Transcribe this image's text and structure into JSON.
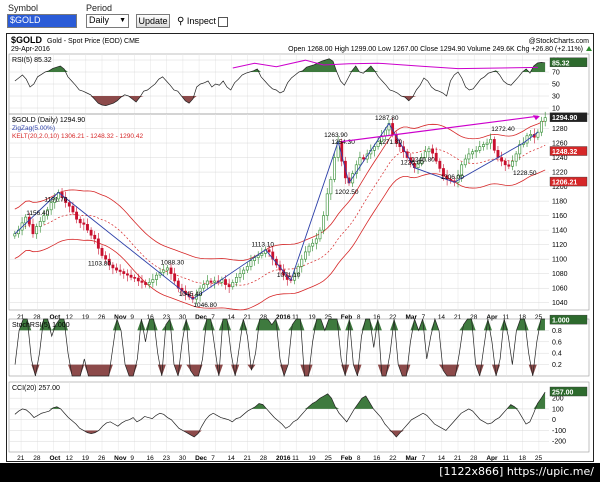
{
  "controls": {
    "symbol_label": "Symbol",
    "symbol_value": "$GOLD",
    "period_label": "Period",
    "period_value": "Daily",
    "update_label": "Update",
    "inspect_label": "Inspect"
  },
  "header": {
    "title": "$GOLD",
    "subtitle": "Gold - Spot Price (EOD)",
    "exchange": "CME",
    "site": "@StockCharts.com",
    "date": "29-Apr-2016",
    "ohlc": "Open 1268.00  High 1299.00  Low 1267.00  Close 1294.90  Volume 249.6K  Chg +26.80 (+2.11%)",
    "change_icon": "up-triangle-icon"
  },
  "legends": {
    "rsi": "RSI(5) 85.32",
    "price": "$GOLD (Daily) 1294.90",
    "zigzag": "ZigZag(5.00%)",
    "kelt": "KELT(20,2.0,10) 1306.21 - 1248.32 - 1290.42",
    "stochrsi": "StochRSI(5) 1.000",
    "cci": "CCI(20) 257.00"
  },
  "footer": "[1122x866] https://upic.me/",
  "colors": {
    "candle_up": "#2d8a2d",
    "candle_down": "#c8102e",
    "indicator_fill_high": "#3e7a3e",
    "indicator_fill_low": "#8c4a4a",
    "keltner": "#d62728",
    "zigzag": "#2c3fa8",
    "annotation": "#cc00cc",
    "grid": "#d8d8d8"
  },
  "chart_data": {
    "type": "candlestick",
    "period": "daily",
    "x_tick_labels": [
      "21",
      "28",
      "Oct",
      "12",
      "19",
      "26",
      "Nov",
      "9",
      "16",
      "23",
      "30",
      "Dec",
      "7",
      "14",
      "21",
      "28",
      "2016",
      "11",
      "19",
      "25",
      "Feb",
      "8",
      "16",
      "22",
      "Mar",
      "7",
      "14",
      "21",
      "28",
      "Apr",
      "11",
      "18",
      "25"
    ],
    "close_series": [
      1135,
      1140,
      1150,
      1158,
      1148,
      1135,
      1145,
      1152,
      1160,
      1168,
      1178,
      1183,
      1192,
      1185,
      1178,
      1173,
      1165,
      1155,
      1150,
      1148,
      1140,
      1133,
      1128,
      1115,
      1105,
      1100,
      1092,
      1088,
      1085,
      1083,
      1080,
      1078,
      1075,
      1074,
      1070,
      1068,
      1065,
      1068,
      1072,
      1078,
      1082,
      1085,
      1088,
      1080,
      1070,
      1060,
      1056,
      1052,
      1048,
      1045,
      1050,
      1060,
      1065,
      1070,
      1068,
      1070,
      1068,
      1072,
      1065,
      1062,
      1068,
      1075,
      1080,
      1085,
      1090,
      1098,
      1102,
      1105,
      1108,
      1113,
      1110,
      1100,
      1092,
      1085,
      1078,
      1072,
      1071,
      1080,
      1090,
      1100,
      1110,
      1118,
      1122,
      1128,
      1140,
      1160,
      1190,
      1210,
      1240,
      1262,
      1235,
      1212,
      1205,
      1218,
      1230,
      1240,
      1238,
      1245,
      1250,
      1255,
      1262,
      1270,
      1278,
      1287,
      1272,
      1260,
      1255,
      1248,
      1240,
      1232,
      1226,
      1232,
      1240,
      1248,
      1252,
      1246,
      1235,
      1225,
      1215,
      1210,
      1208,
      1206,
      1215,
      1230,
      1238,
      1245,
      1248,
      1250,
      1255,
      1258,
      1260,
      1265,
      1250,
      1240,
      1235,
      1230,
      1228,
      1235,
      1245,
      1258,
      1260,
      1270,
      1272,
      1268,
      1275,
      1290,
      1295
    ],
    "price_labels": [
      {
        "text": "1156.40",
        "value": 1156.4
      },
      {
        "text": "1191.70",
        "value": 1191.7
      },
      {
        "text": "1103.80",
        "value": 1103.8
      },
      {
        "text": "1088.30",
        "value": 1088.3
      },
      {
        "text": "1045.40",
        "value": 1045.4
      },
      {
        "text": "1046.80",
        "value": 1046.8
      },
      {
        "text": "1113.10",
        "value": 1113.1
      },
      {
        "text": "1071.10",
        "value": 1071.1
      },
      {
        "text": "1263.90",
        "value": 1263.9
      },
      {
        "text": "1254.30",
        "value": 1254.3
      },
      {
        "text": "1202.50",
        "value": 1202.5
      },
      {
        "text": "1287.80",
        "value": 1287.8
      },
      {
        "text": "1271.30",
        "value": 1271.3
      },
      {
        "text": "1226.00",
        "value": 1226.0
      },
      {
        "text": "1246.80",
        "value": 1246.8
      },
      {
        "text": "1206.00",
        "value": 1206.0
      },
      {
        "text": "1272.40",
        "value": 1272.4
      },
      {
        "text": "1228.50",
        "value": 1228.5
      }
    ],
    "price_axis": {
      "ylim": [
        1030,
        1300
      ],
      "ticks": [
        1040,
        1060,
        1080,
        1100,
        1120,
        1140,
        1160,
        1180,
        1200,
        1220,
        1240,
        1260,
        1280
      ]
    },
    "price_tags": [
      "1294.90",
      "1248.32",
      "1206.21"
    ],
    "rsi": {
      "axis_ticks": [
        10,
        30,
        50,
        70,
        90
      ],
      "ylim": [
        0,
        100
      ],
      "tag": "85.32",
      "values": [
        55,
        60,
        65,
        58,
        45,
        50,
        62,
        66,
        70,
        72,
        76,
        78,
        80,
        75,
        62,
        55,
        48,
        40,
        38,
        35,
        32,
        25,
        18,
        15,
        14,
        16,
        18,
        22,
        28,
        32,
        30,
        25,
        20,
        28,
        38,
        40,
        45,
        50,
        58,
        62,
        55,
        48,
        40,
        38,
        30,
        22,
        18,
        25,
        45,
        50,
        52,
        55,
        45,
        50,
        48,
        55,
        45,
        40,
        52,
        58,
        65,
        68,
        70,
        72,
        75,
        62,
        55,
        48,
        42,
        40,
        35,
        38,
        52,
        60,
        65,
        70,
        72,
        78,
        80,
        82,
        85,
        88,
        90,
        92,
        88,
        70,
        55,
        48,
        60,
        72,
        80,
        70,
        68,
        74,
        80,
        72,
        62,
        55,
        48,
        40,
        38,
        35,
        30,
        28,
        22,
        28,
        40,
        48,
        60,
        55,
        45,
        40,
        38,
        35,
        30,
        55,
        65,
        70,
        60,
        45,
        40,
        42,
        50,
        58,
        62,
        68,
        70,
        72,
        65,
        55,
        50,
        48,
        55,
        62,
        70,
        75,
        68,
        80,
        85,
        86,
        85.3
      ]
    },
    "stochrsi": {
      "axis_ticks": [
        "0.8",
        "0.6",
        "0.4",
        "0.2"
      ],
      "ylim": [
        0,
        1
      ],
      "tag": "1.000",
      "values": [
        0.2,
        0.8,
        1,
        1,
        0.3,
        0,
        0.4,
        1,
        1,
        0.7,
        0.9,
        1,
        1,
        0.4,
        0,
        0,
        0,
        0.3,
        0,
        0,
        0,
        0,
        0,
        0,
        0.5,
        1,
        0.8,
        0.2,
        0,
        0,
        0.3,
        1,
        0.6,
        1,
        1,
        0.4,
        0,
        0.9,
        1,
        0.2,
        0,
        0.6,
        1,
        0.1,
        0,
        0,
        0.3,
        1,
        1,
        0.5,
        0,
        1,
        1,
        0.4,
        0,
        0.5,
        1,
        0.7,
        0.1,
        0.4,
        1,
        1,
        1,
        0.9,
        1,
        0.3,
        0,
        0.2,
        0.9,
        1,
        1,
        0,
        0,
        0.6,
        1,
        1,
        0.8,
        1,
        1,
        1,
        0.3,
        0,
        1,
        0.2,
        0,
        0.7,
        1,
        1,
        0.5,
        1,
        0,
        0,
        0.4,
        1,
        0.2,
        0,
        0,
        0.6,
        1,
        0.8,
        1,
        0.3,
        0.7,
        1,
        0.8,
        0.1,
        0,
        0,
        0,
        0.4,
        0.9,
        1,
        1,
        0.2,
        0,
        0.5,
        1,
        0.6,
        0,
        0.3,
        1,
        0.7,
        0.2,
        0.8,
        1,
        1,
        0.4,
        0,
        0.6,
        1,
        1
      ]
    },
    "cci": {
      "axis_ticks": [
        "200",
        "100",
        "0",
        "-100",
        "-200"
      ],
      "ylim": [
        -300,
        350
      ],
      "tag": "257.00",
      "values": [
        50,
        80,
        100,
        90,
        60,
        20,
        40,
        60,
        70,
        80,
        110,
        120,
        100,
        60,
        20,
        -10,
        -40,
        -80,
        -100,
        -120,
        -130,
        -120,
        -100,
        -60,
        -30,
        -20,
        -40,
        -60,
        -30,
        -10,
        0,
        20,
        -20,
        0,
        30,
        20,
        10,
        40,
        60,
        50,
        20,
        0,
        -40,
        -80,
        -100,
        -120,
        -140,
        -160,
        -130,
        -60,
        0,
        40,
        60,
        40,
        20,
        10,
        0,
        -20,
        10,
        20,
        50,
        80,
        100,
        120,
        150,
        140,
        100,
        60,
        20,
        -10,
        -40,
        -80,
        -60,
        -20,
        0,
        40,
        80,
        120,
        150,
        170,
        200,
        220,
        240,
        200,
        120,
        60,
        20,
        -20,
        40,
        100,
        150,
        200,
        220,
        160,
        100,
        60,
        20,
        -40,
        -80,
        -120,
        -160,
        -120,
        -80,
        -40,
        0,
        20,
        40,
        60,
        40,
        0,
        -40,
        -60,
        -80,
        -100,
        -60,
        -20,
        20,
        60,
        80,
        100,
        80,
        40,
        0,
        -20,
        -40,
        -30,
        0,
        20,
        60,
        100,
        140,
        120,
        80,
        20,
        -40,
        -20,
        60,
        150,
        200,
        257
      ]
    }
  }
}
